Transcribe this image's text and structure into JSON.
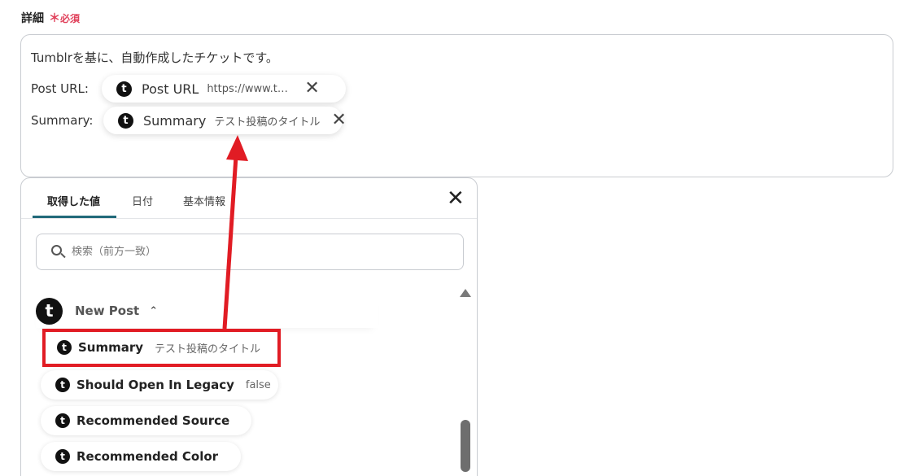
{
  "field": {
    "label": "詳細",
    "required_mark": "＊",
    "required_text": "必須"
  },
  "editor": {
    "line1": "Tumblrを基に、自動作成したチケットです。",
    "line2_label": "Post URL:",
    "line3_label": "Summary:",
    "chips": [
      {
        "name": "Post URL",
        "value": "https://www.tumb..."
      },
      {
        "name": "Summary",
        "value": "テスト投稿のタイトル"
      }
    ]
  },
  "panel": {
    "tabs": [
      {
        "label": "取得した値",
        "active": true
      },
      {
        "label": "日付"
      },
      {
        "label": "基本情報"
      }
    ],
    "close_icon": "close-icon",
    "search": {
      "placeholder": "検索（前方一致）",
      "value": ""
    },
    "group": {
      "title": "New Post",
      "expanded": true
    },
    "items": [
      {
        "name": "Summary",
        "value": "テスト投稿のタイトル",
        "highlighted": true
      },
      {
        "name": "Should Open In Legacy",
        "value": "false"
      },
      {
        "name": "Recommended Source",
        "value": ""
      },
      {
        "name": "Recommended Color",
        "value": ""
      }
    ]
  },
  "logo_letter": "t",
  "colors": {
    "accent_tab": "#216a7a",
    "required": "#e0405a",
    "highlight": "#e11c24",
    "logo_bg": "#111111"
  }
}
